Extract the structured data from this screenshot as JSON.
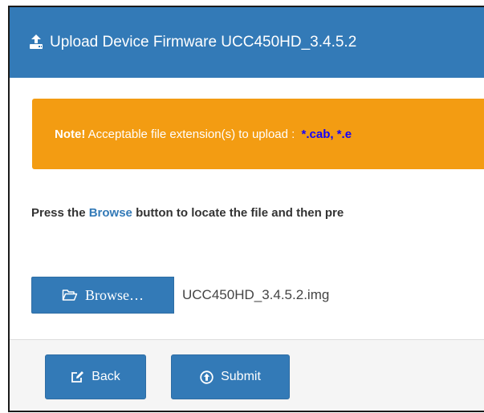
{
  "header": {
    "title": "Upload Device Firmware UCC450HD_3.4.5.2",
    "icon": "upload-icon"
  },
  "note": {
    "label": "Note!",
    "text": " Acceptable file extension(s) to upload : ",
    "extensions": "*.cab, *.e"
  },
  "instructions": {
    "part1": "Press the ",
    "browse_word": "Browse",
    "part2": " button to locate the file and then pre"
  },
  "file": {
    "browse_label": "Browse…",
    "browse_icon": "folder-open-icon",
    "selected_filename": "UCC450HD_3.4.5.2.img"
  },
  "footer": {
    "back_label": "Back",
    "back_icon": "edit-icon",
    "submit_label": "Submit",
    "submit_icon": "circle-arrow-up-icon"
  },
  "colors": {
    "primary": "#337ab7",
    "warning": "#f39c12",
    "extension_text": "#1200ff"
  }
}
